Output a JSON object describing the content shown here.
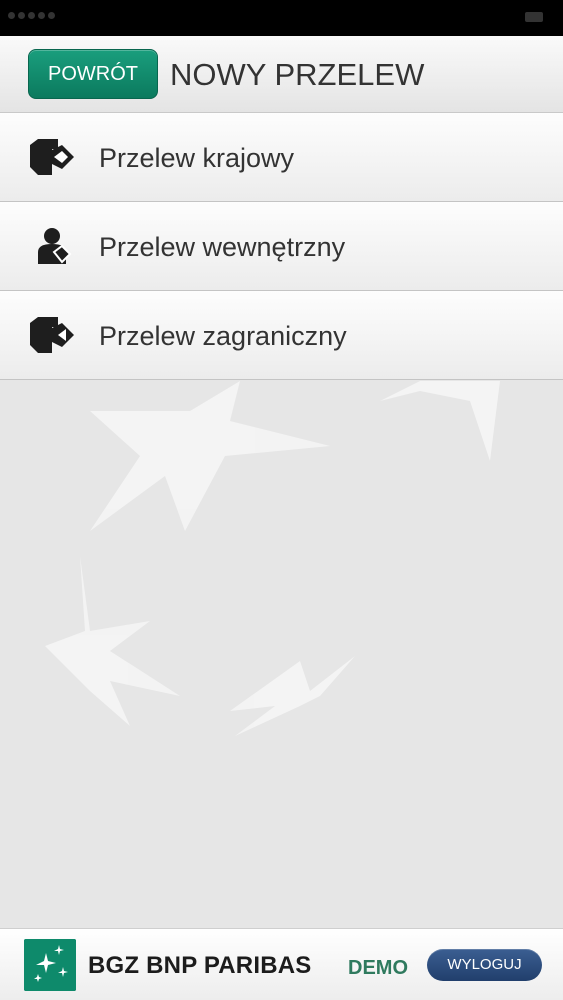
{
  "header": {
    "back_label": "POWRÓT",
    "title": "NOWY PRZELEW"
  },
  "menu": {
    "items": [
      {
        "label": "Przelew krajowy",
        "icon": "domestic-transfer-icon"
      },
      {
        "label": "Przelew wewnętrzny",
        "icon": "internal-transfer-icon"
      },
      {
        "label": "Przelew zagraniczny",
        "icon": "foreign-transfer-icon"
      }
    ]
  },
  "footer": {
    "brand": "BGZ BNP PARIBAS",
    "demo": "DEMO",
    "logout_label": "WYLOGUJ"
  },
  "colors": {
    "accent": "#0e8a6b",
    "logout": "#2b4a78",
    "demo": "#2f7a5e"
  }
}
